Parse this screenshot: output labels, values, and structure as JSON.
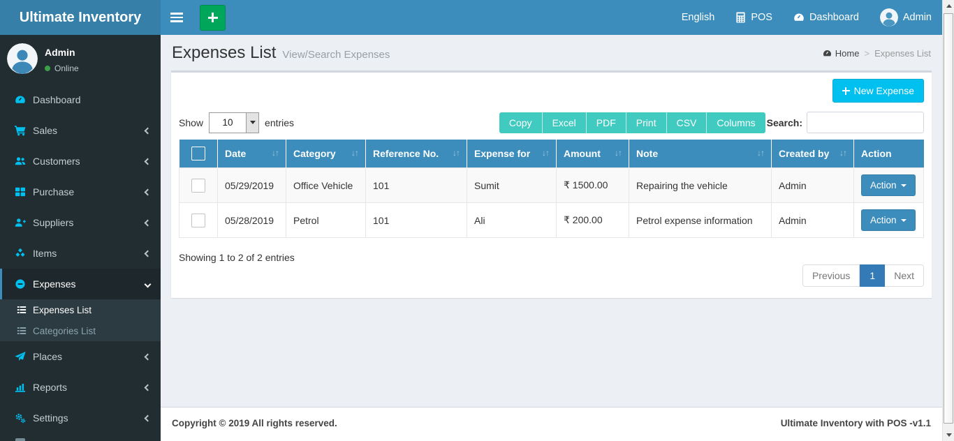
{
  "brand": {
    "title": "Ultimate Inventory"
  },
  "navbar": {
    "language": "English",
    "pos": "POS",
    "dashboard": "Dashboard",
    "username": "Admin"
  },
  "sidebar": {
    "user": {
      "name": "Admin",
      "status": "Online"
    },
    "items": [
      {
        "label": "Dashboard"
      },
      {
        "label": "Sales"
      },
      {
        "label": "Customers"
      },
      {
        "label": "Purchase"
      },
      {
        "label": "Suppliers"
      },
      {
        "label": "Items"
      },
      {
        "label": "Expenses"
      },
      {
        "label": "Places"
      },
      {
        "label": "Reports"
      },
      {
        "label": "Settings"
      }
    ],
    "submenu": [
      {
        "label": "Expenses List"
      },
      {
        "label": "Categories List"
      }
    ]
  },
  "page": {
    "title": "Expenses List",
    "subtitle": "View/Search Expenses",
    "breadcrumb": {
      "home": "Home",
      "current": "Expenses List"
    }
  },
  "toolbar": {
    "new_expense": "New Expense",
    "show_label": "Show",
    "page_length": "10",
    "entries_label": "entries",
    "export_buttons": [
      "Copy",
      "Excel",
      "PDF",
      "Print",
      "CSV",
      "Columns"
    ],
    "search_label": "Search:"
  },
  "table": {
    "sort_icon": "↓↑",
    "columns": [
      "Date",
      "Category",
      "Reference No.",
      "Expense for",
      "Amount",
      "Note",
      "Created by",
      "Action"
    ],
    "rows": [
      {
        "date": "05/29/2019",
        "category": "Office Vehicle",
        "reference": "101",
        "expense_for": "Sumit",
        "amount": "₹ 1500.00",
        "note": "Repairing the vehicle",
        "created_by": "Admin",
        "action": "Action"
      },
      {
        "date": "05/28/2019",
        "category": "Petrol",
        "reference": "101",
        "expense_for": "Ali",
        "amount": "₹ 200.00",
        "note": "Petrol expense information",
        "created_by": "Admin",
        "action": "Action"
      }
    ]
  },
  "info_text": "Showing 1 to 2 of 2 entries",
  "pagination": {
    "previous": "Previous",
    "page": "1",
    "next": "Next"
  },
  "footer": {
    "left": "Copyright © 2019 All rights reserved.",
    "right": "Ultimate Inventory with POS -v1.1"
  },
  "colors": {
    "navbar": "#3c8dbc",
    "logo_bg": "#367fa9",
    "sidebar": "#222d32",
    "sidebar_icon": "#00c0ef",
    "active_item_bg": "#1e282c",
    "export_button": "#41cac0",
    "new_expense_button": "#00c0ef",
    "add_button_green": "#00a65a",
    "table_header": "#3c8dbc",
    "pagination_active": "#337ab7"
  }
}
